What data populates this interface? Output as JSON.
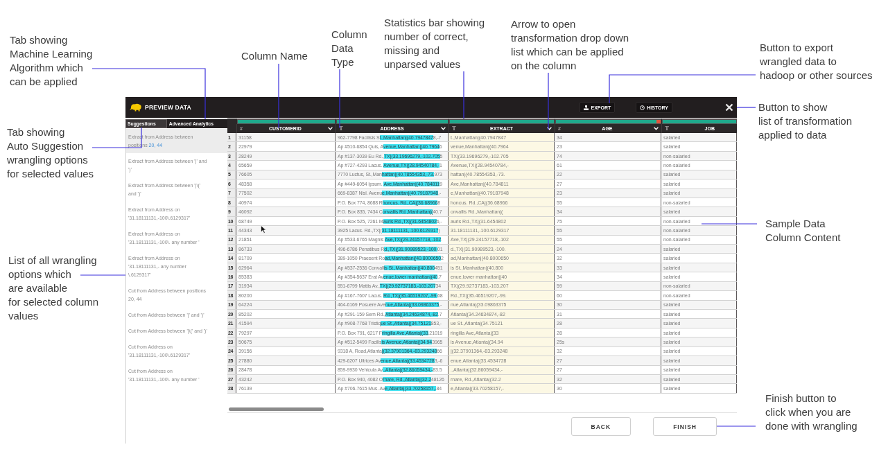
{
  "callouts": [
    {
      "lines": [
        "Tab showing",
        "Machine Learning",
        "Algorithm which",
        "can be applied"
      ]
    },
    {
      "lines": [
        "Column Name"
      ]
    },
    {
      "lines": [
        "Column",
        "Data",
        "Type"
      ]
    },
    {
      "lines": [
        "Statistics bar showing",
        "number of correct,",
        "missing and",
        "unparsed values"
      ]
    },
    {
      "lines": [
        "Arrow to open",
        "transformation drop down",
        "list which can be applied",
        "on the column"
      ]
    },
    {
      "lines": [
        "Button to export",
        "wrangled data to",
        "hadoop or other sources"
      ]
    },
    {
      "lines": [
        "Tab showing",
        "Auto Suggestion",
        "wrangling options",
        "for selected values"
      ]
    },
    {
      "lines": [
        "List of all wrangling",
        "options which",
        "are available",
        "for selected column",
        "values"
      ]
    },
    {
      "lines": [
        "Button to show",
        "list of transformation",
        "applied to data"
      ]
    },
    {
      "lines": [
        "Sample Data",
        "Column Content"
      ]
    },
    {
      "lines": [
        "Finish button to",
        "click when you are",
        "done with wrangling"
      ]
    }
  ],
  "app": {
    "title": "PREVIEW DATA",
    "actions": [
      {
        "kind": "export",
        "label": "EXPORT"
      },
      {
        "kind": "history",
        "label": "HISTORY"
      }
    ],
    "sidebar_tabs": [
      {
        "label": "Suggestions",
        "selected": true
      },
      {
        "label": "Advanced Analytics",
        "selected": false
      }
    ],
    "suggestions": [
      {
        "text": "Extract from Address between positions",
        "value": "20, 44",
        "selected": true
      },
      {
        "text": "Extract from Address between '|' and ')'",
        "selected": false
      },
      {
        "text": "Extract from Address between '|\\(' and ')'",
        "selected": false
      },
      {
        "text": "Extract from Address on '31.18111131,-100\\.6129317'",
        "selected": false
      },
      {
        "text": "Extract from Address on '31.18111131,-100\\. any number '",
        "selected": false
      },
      {
        "text": "Extract from Address on '31.18111131,- any number \\.6129317'",
        "selected": false
      },
      {
        "text": "Cut from Address between positions 20, 44",
        "selected": false
      },
      {
        "text": "Cut from Address between '|' and ')'",
        "selected": false
      },
      {
        "text": "Cut from Address between '|\\(' and ')'",
        "selected": false
      },
      {
        "text": "Cut from Address on '31.18111131,-100\\.6129317'",
        "selected": false
      },
      {
        "text": "Cut from Address on '31.18111131,-100\\. any number '",
        "selected": false
      }
    ],
    "table": {
      "columns": [
        {
          "kind": "number",
          "type_symbol": "#",
          "name": "CUSTOMERID",
          "level": 1,
          "menu_arrow": true,
          "preview": false
        },
        {
          "kind": "text",
          "type_symbol": "T",
          "name": "ADDRESS",
          "level": 1,
          "menu_arrow": true,
          "preview": false
        },
        {
          "kind": "text",
          "type_symbol": "T",
          "name": "EXTRACT",
          "level": 1,
          "menu_arrow": true,
          "preview": true
        },
        {
          "kind": "number",
          "type_symbol": "#",
          "name": "AGE",
          "level": 0.96,
          "menu_arrow": true,
          "preview": false
        },
        {
          "kind": "text",
          "type_symbol": "T",
          "name": "JOB",
          "level": 1,
          "menu_arrow": false,
          "preview": false
        }
      ],
      "rows": [
        {
          "number": "1",
          "cells": [
            "31158",
            {
              "before": "962-7798 Facilisis S",
              "highlight": "t.,Manhattan|(40.7947847",
              "after": "8,-7"
            },
            "t.,Manhattan|(40.7947847",
            "34",
            "salaried"
          ]
        },
        {
          "number": "2",
          "cells": [
            "22979",
            {
              "before": "Ap #510-6854 Quis, A",
              "highlight": "venue,Manhattan|(40.7964",
              "after": "6"
            },
            "venue,Manhattan|(40.7964",
            "23",
            "salaried"
          ]
        },
        {
          "number": "3",
          "cells": [
            "28249",
            {
              "before": "Ap #137-3039 Eu Rd.,",
              "highlight": "TX|(33.19696279,-102.705",
              "after": "5"
            },
            "TX|(33.19696279,-102.705",
            "74",
            "non-salaried"
          ]
        },
        {
          "number": "4",
          "cells": [
            "65659",
            {
              "before": "Ap #727-4293 Lacus. ",
              "highlight": "Avenue,TX|(28.94540784,-",
              "after": "1"
            },
            "Avenue,TX|(28.94540784,-",
            "61",
            "non-salaried"
          ]
        },
        {
          "number": "5",
          "cells": [
            "76605",
            {
              "before": "7770 Luctus, St.,Man",
              "highlight": "hattan|(40.78554353,-73.",
              "after": "973"
            },
            "hattan|(40.78554353,-73.",
            "22",
            "salaried"
          ]
        },
        {
          "number": "6",
          "cells": [
            "48358",
            {
              "before": "Ap #449-6054 Ipsum. ",
              "highlight": "Ave,Manhattan|(40.784811",
              "after": "9"
            },
            "Ave,Manhattan|(40.784811",
            "27",
            "salaried"
          ]
        },
        {
          "number": "7",
          "cells": [
            "77502",
            {
              "before": "669-8387 Nisl. Avenu",
              "highlight": "e,Manhattan|(40.79187948",
              "after": ",-"
            },
            "e,Manhattan|(40.79187948",
            "23",
            "salaried"
          ]
        },
        {
          "number": "8",
          "cells": [
            "40974",
            {
              "before": "P.O. Box 774, 8688 R",
              "highlight": "honcus. Rd.,CA|(36.68966",
              "after": "8"
            },
            "honcus. Rd.,CA|(36.68966",
            "55",
            "non-salaried"
          ]
        },
        {
          "number": "9",
          "cells": [
            "46092",
            {
              "before": "P.O. Box 835, 7434 C",
              "highlight": "onvallis Rd.,Manhattan|(",
              "after": "40.7"
            },
            "onvallis Rd.,Manhattan|(",
            "34",
            "salaried"
          ]
        },
        {
          "number": "10",
          "cells": [
            "68749",
            {
              "before": "P.O. Box 525, 7261 M",
              "highlight": "auris Rd.,TX|(31.6454802",
              "after": "6,-"
            },
            "auris Rd.,TX|(31.6454802",
            "75",
            "non-salaried"
          ]
        },
        {
          "number": "11",
          "cells": [
            "44343",
            {
              "before": "3925 Lacus. Rd.,TX|(",
              "highlight": "31.18111131,-100.6129317",
              "after": ")"
            },
            "31.18111131,-100.6129317",
            "55",
            "non-salaried"
          ]
        },
        {
          "number": "12",
          "cells": [
            "21851",
            {
              "before": "Ap #533-6765 Magnis ",
              "highlight": "Ave,TX|(29.24157718,-102",
              "after": "."
            },
            "Ave,TX|(29.24157718,-102",
            "55",
            "non-salaried"
          ]
        },
        {
          "number": "13",
          "cells": [
            "86733",
            {
              "before": "496-6786 Penatibus R",
              "highlight": "d.,TX|(31.90989523,-100.",
              "after": "01"
            },
            "d.,TX|(31.90989523,-100.",
            "24",
            "salaried"
          ]
        },
        {
          "number": "14",
          "cells": [
            "81709",
            {
              "before": "389-1050 Praesent Ro",
              "highlight": "ad,Manhattan|(40.8000650",
              "after": "2"
            },
            "ad,Manhattan|(40.8000650",
            "32",
            "salaried"
          ]
        },
        {
          "number": "15",
          "cells": [
            "62964",
            {
              "before": "Ap #537-2536 Convall",
              "highlight": "is St.,Manhattan|(40.800",
              "after": "451"
            },
            "is St.,Manhattan|(40.800",
            "33",
            "salaried"
          ]
        },
        {
          "number": "16",
          "cells": [
            "85383",
            {
              "before": "Ap #354-5637 Erat Av",
              "highlight": "enue,lower manhattan|(40",
              "after": ".7"
            },
            "enue,lower manhattan|(40",
            "34",
            "salaried"
          ]
        },
        {
          "number": "17",
          "cells": [
            "31934",
            {
              "before": "551-6799 Mattis Av.,",
              "highlight": "TX|(29.92737183,-103.207",
              "after": "34"
            },
            "TX|(29.92737183,-103.207",
            "59",
            "non-salaried"
          ]
        },
        {
          "number": "18",
          "cells": [
            "80200",
            {
              "before": "Ap #167-7607 Lacus. ",
              "highlight": "Rd.,TX|(35.46519207,-99.",
              "after": "68"
            },
            "Rd.,TX|(35.46519207,-99.",
            "60",
            "non-salaried"
          ]
        },
        {
          "number": "19",
          "cells": [
            "64224",
            {
              "before": "464-6169 Posuere Ave",
              "highlight": "nue,Atlanta|(33.09863375",
              "after": ",-"
            },
            "nue,Atlanta|(33.09863375",
            "30",
            "salaried"
          ]
        },
        {
          "number": "20",
          "cells": [
            "85202",
            {
              "before": "Ap #291-159 Sem Rd.,",
              "highlight": "Atlanta|(34.24634874,-82",
              "after": ".7"
            },
            "Atlanta|(34.24634874,-82",
            "31",
            "salaried"
          ]
        },
        {
          "number": "21",
          "cells": [
            "41594",
            {
              "before": "Ap #908-7768 Tristiq",
              "highlight": "ue St.,Atlanta|(34.75121",
              "after": "853,-"
            },
            "ue St.,Atlanta|(34.75121",
            "28",
            "salaried"
          ]
        },
        {
          "number": "22",
          "cells": [
            "79297",
            {
              "before": "P.O. Box 791, 6217 F",
              "highlight": "ringilla Ave,Atlanta|(33",
              "after": ".21019"
            },
            "ringilla Ave,Atlanta|(33",
            "28",
            "salaried"
          ]
        },
        {
          "number": "23",
          "cells": [
            "50675",
            {
              "before": "Ap #512-5499 Facilis",
              "highlight": "is Avenue,Atlanta|(34.94",
              "after": "3965"
            },
            "is Avenue,Atlanta|(34.94",
            "25s",
            "salaried"
          ]
        },
        {
          "number": "24",
          "cells": [
            "39156",
            {
              "before": "9318 A, Road,Atlanta",
              "highlight": "|(32.37901364,-83.293248",
              "after": "66"
            },
            "|(32.37901364,-83.293248",
            "32",
            "salaried"
          ]
        },
        {
          "number": "25",
          "cells": [
            "27880",
            {
              "before": "429-6207 Ultrices Av",
              "highlight": "enue,Atlanta|(33.4534728",
              "after": "3,-6"
            },
            "enue,Atlanta|(33.4534728",
            "27",
            "salaried"
          ]
        },
        {
          "number": "26",
          "cells": [
            "28478",
            {
              "before": "859-9930 Vehicula Av",
              "highlight": ".,Atlanta|(32.86059434,-",
              "after": "83.5"
            },
            ".,Atlanta|(32.86059434,-",
            "27",
            "salaried"
          ]
        },
        {
          "number": "27",
          "cells": [
            "43242",
            {
              "before": "P.O. Box 940, 4082 O",
              "highlight": "rnare, Rd.,Atlanta|(32.2",
              "after": "48126"
            },
            "rnare, Rd.,Atlanta|(32.2",
            "32",
            "salaried"
          ]
        },
        {
          "number": "28",
          "cells": [
            "76139",
            {
              "before": "Ap #706-7615 Mus. Av",
              "highlight": "e,Atlanta|(33.70258157,-",
              "after": "84"
            },
            "e,Atlanta|(33.70258157,-",
            "30",
            "salaried"
          ]
        }
      ]
    },
    "footer_buttons": [
      "BACK",
      "FINISH"
    ]
  }
}
